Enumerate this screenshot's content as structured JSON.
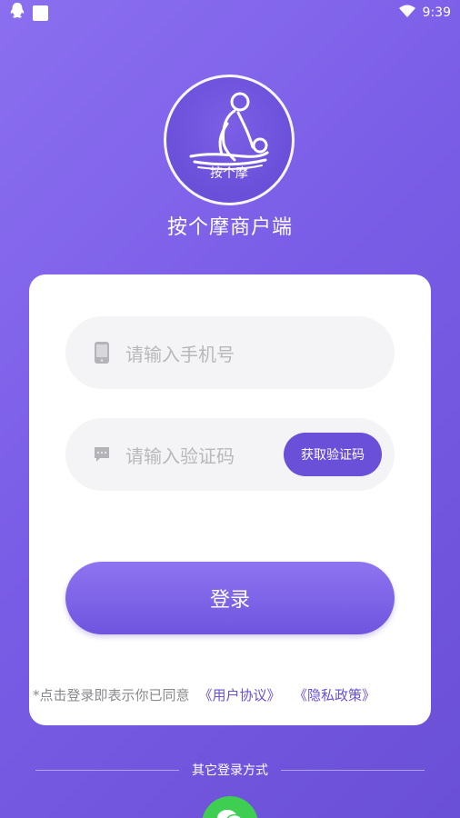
{
  "status_bar": {
    "time": "9:39",
    "left_icons": [
      "qq-icon",
      "notification-square-icon"
    ],
    "right_icons": [
      "wifi-icon"
    ]
  },
  "logo": {
    "text": "按个摩"
  },
  "app": {
    "title": "按个摩商户端"
  },
  "form": {
    "phone_placeholder": "请输入手机号",
    "code_placeholder": "请输入验证码",
    "get_code_label": "获取验证码",
    "login_label": "登录"
  },
  "agreement": {
    "prefix": "*点击登录即表示你已同意",
    "user_agreement": "《用户协议》",
    "privacy_policy": "《隐私政策》"
  },
  "other_login": {
    "label": "其它登录方式",
    "methods": [
      "wechat-icon"
    ]
  },
  "colors": {
    "accent": "#6a4fd9",
    "background_start": "#8b6ff0",
    "background_end": "#6a50d6",
    "wechat": "#3ecf52"
  }
}
